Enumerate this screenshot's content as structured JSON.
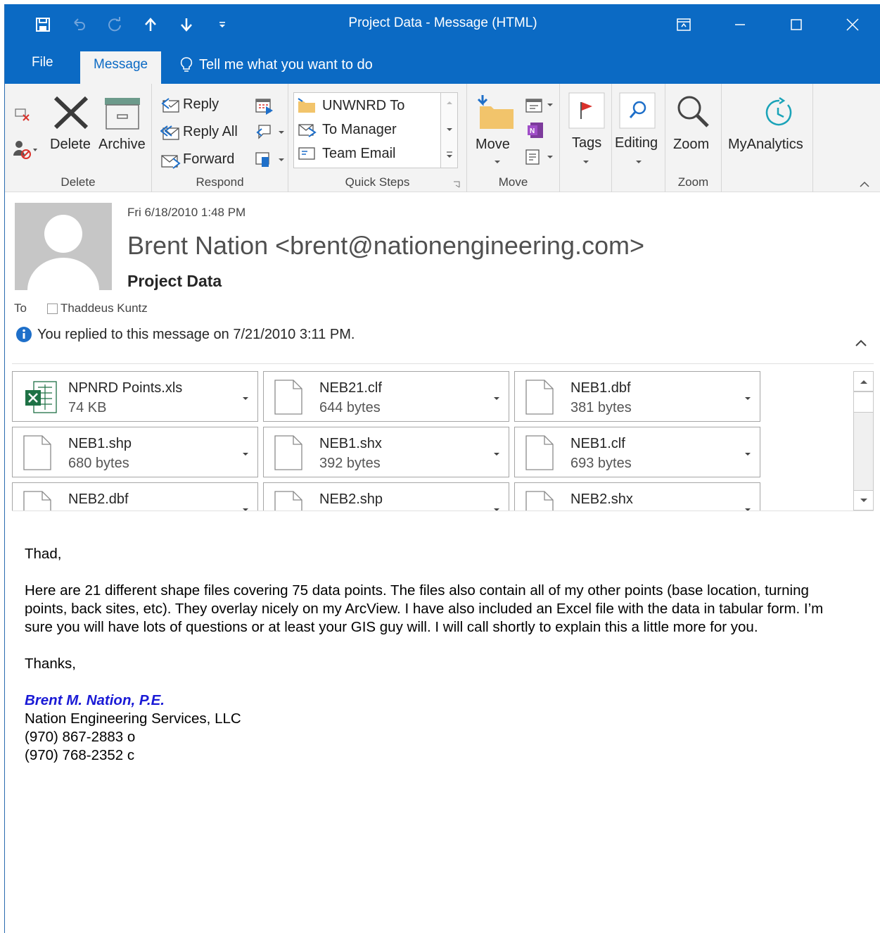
{
  "window": {
    "title": "Project Data - Message (HTML)"
  },
  "tabs": {
    "file": "File",
    "message": "Message",
    "tell_me": "Tell me what you want to do"
  },
  "ribbon": {
    "delete_group": {
      "delete_label": "Delete",
      "archive_label": "Archive",
      "group_label": "Delete"
    },
    "respond_group": {
      "reply": "Reply",
      "reply_all": "Reply All",
      "forward": "Forward",
      "group_label": "Respond"
    },
    "quick_steps": {
      "items": [
        "UNWNRD To",
        "To Manager",
        "Team Email"
      ],
      "group_label": "Quick Steps"
    },
    "move_group": {
      "move": "Move",
      "group_label": "Move"
    },
    "tags": "Tags",
    "editing": "Editing",
    "zoom_group": {
      "zoom": "Zoom",
      "group_label": "Zoom"
    },
    "my_analytics": "MyAnalytics"
  },
  "header": {
    "date": "Fri 6/18/2010 1:48 PM",
    "sender": "Brent Nation <brent@nationengineering.com>",
    "subject": "Project Data",
    "to_label": "To",
    "recipient": "Thaddeus Kuntz",
    "info": "You replied to this message on 7/21/2010 3:11 PM."
  },
  "attachments": [
    {
      "name": "NPNRD Points.xls",
      "size": "74 KB",
      "type": "excel"
    },
    {
      "name": "NEB21.clf",
      "size": "644 bytes",
      "type": "file"
    },
    {
      "name": "NEB1.dbf",
      "size": "381 bytes",
      "type": "file"
    },
    {
      "name": "NEB1.shp",
      "size": "680 bytes",
      "type": "file"
    },
    {
      "name": "NEB1.shx",
      "size": "392 bytes",
      "type": "file"
    },
    {
      "name": "NEB1.clf",
      "size": "693 bytes",
      "type": "file"
    },
    {
      "name": "NEB2.dbf",
      "size": "",
      "type": "file"
    },
    {
      "name": "NEB2.shp",
      "size": "",
      "type": "file"
    },
    {
      "name": "NEB2.shx",
      "size": "",
      "type": "file"
    }
  ],
  "body": {
    "greeting": "Thad,",
    "paragraph": "Here are 21 different shape files covering 75 data points. The files also contain all of my other points (base location, turning points, back sites, etc). They overlay nicely on my ArcView. I have also included an Excel file with the data in tabular form. I’m sure you will have lots of questions or at least your GIS guy will. I will call shortly to explain this a little more for you.",
    "closing": "Thanks,",
    "signature": {
      "name": "Brent M. Nation, P.E.",
      "company": "Nation Engineering Services, LLC",
      "phone_office": "(970) 867-2883 o",
      "phone_cell": "(970) 768-2352 c"
    }
  },
  "colors": {
    "title_bar": "#0b6ac4",
    "ribbon_bg": "#f3f3f3",
    "signature_blue": "#1a1ad6",
    "info_blue": "#1e6fc9",
    "flag_red": "#d9312b"
  }
}
